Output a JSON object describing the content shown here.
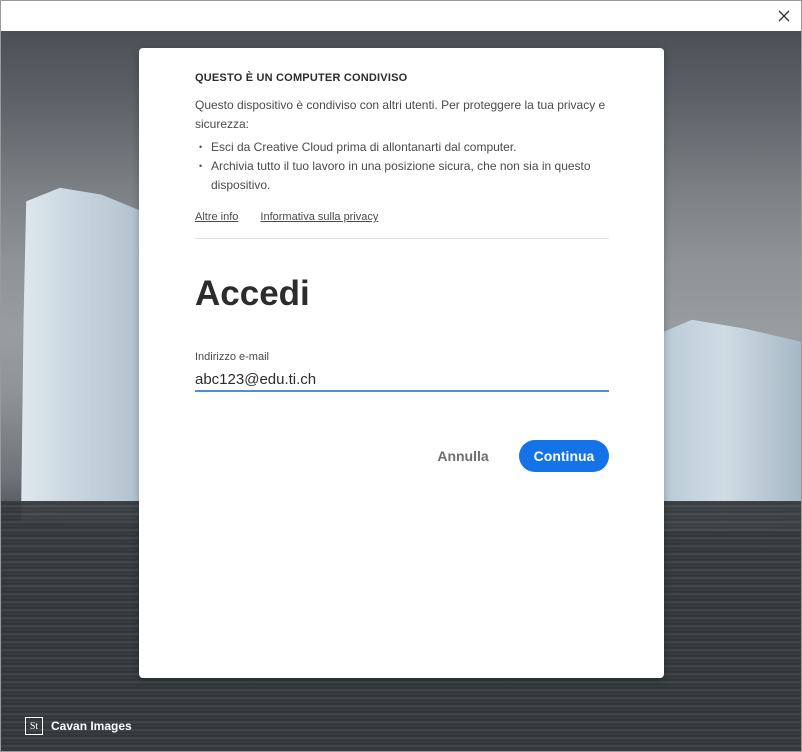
{
  "window": {
    "close_icon": "close-icon"
  },
  "notice": {
    "title": "QUESTO È UN COMPUTER CONDIVISO",
    "text": "Questo dispositivo è condiviso con altri utenti. Per proteggere la tua privacy e sicurezza:",
    "items": [
      "Esci da Creative Cloud prima di allontanarti dal computer.",
      "Archivia tutto il tuo lavoro in una posizione sicura, che non sia in questo dispositivo."
    ],
    "links": {
      "more_info": "Altre info",
      "privacy": "Informativa sulla privacy"
    }
  },
  "signin": {
    "heading": "Accedi",
    "email_label": "Indirizzo e-mail",
    "email_value": "abc123@edu.ti.ch",
    "cancel_label": "Annulla",
    "continue_label": "Continua"
  },
  "credit": {
    "icon_text": "St",
    "text": "Cavan Images"
  },
  "colors": {
    "accent": "#1473e6",
    "input_focus": "#4a90d9"
  }
}
